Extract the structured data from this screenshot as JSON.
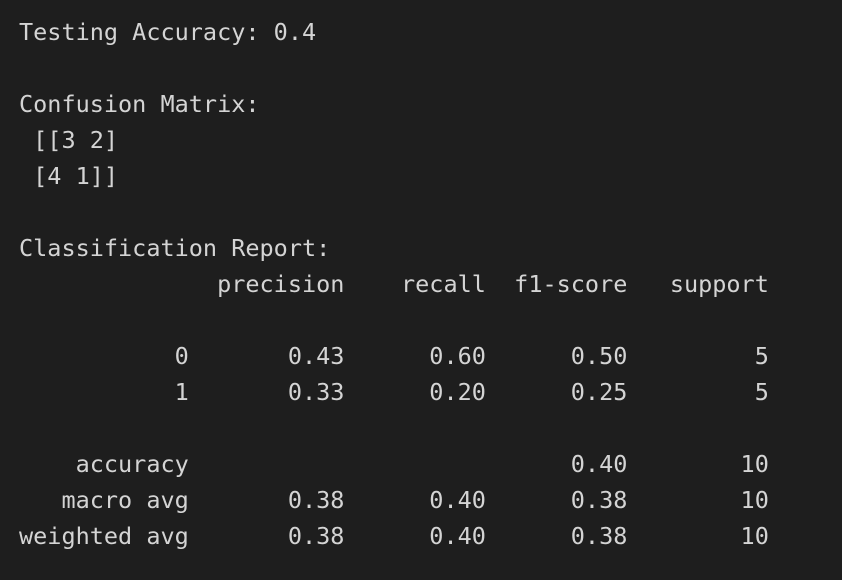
{
  "output": {
    "testing_accuracy": "Testing Accuracy: 0.4",
    "confusion_matrix_label": "Confusion Matrix:",
    "confusion_matrix_rows": [
      " [[3 2]",
      " [4 1]]"
    ],
    "classification_report_label": "Classification Report:",
    "report_header": "              precision    recall  f1-score   support",
    "report_rows": [
      "           0       0.43      0.60      0.50         5",
      "           1       0.33      0.20      0.25         5"
    ],
    "summary_rows": [
      "    accuracy                           0.40        10",
      "   macro avg       0.38      0.40      0.38        10",
      "weighted avg       0.38      0.40      0.38        10"
    ]
  },
  "colors": {
    "background": "#1e1e1e",
    "text": "#d4d4d4"
  }
}
